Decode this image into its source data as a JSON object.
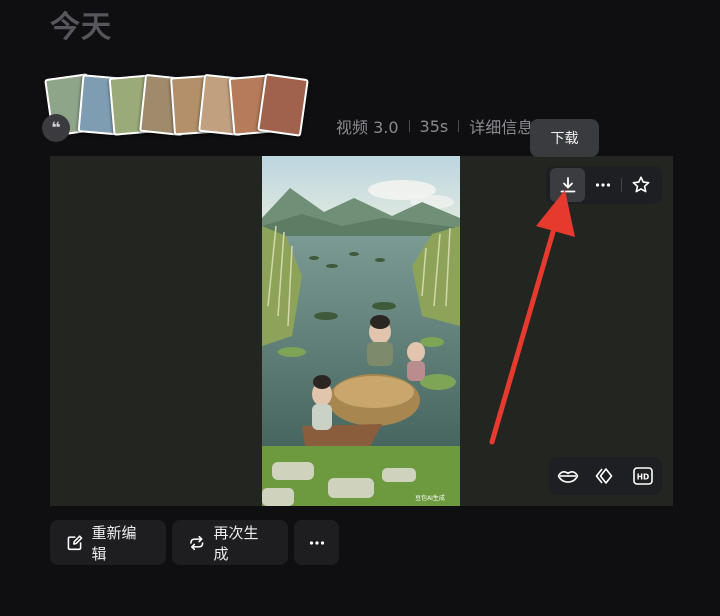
{
  "section": {
    "title": "今天"
  },
  "thumbnails": {
    "count": 8,
    "colors": [
      "#8fa58a",
      "#7f9db2",
      "#9aaa78",
      "#a08a6c",
      "#b3906a",
      "#c0a07e",
      "#b57b5a",
      "#a0624c"
    ],
    "quote_icon": "quote-icon"
  },
  "meta": {
    "model": "视频 3.0",
    "duration": "35s",
    "details": "详细信息"
  },
  "tooltip": {
    "download": "下载"
  },
  "video": {
    "watermark": "豆包AI生成",
    "palette": {
      "sky": "#cfe0e4",
      "mountain": "#6f8f76",
      "water": "#5b7e78",
      "reeds": "#8ea35a",
      "grass": "#6e9a3f"
    }
  },
  "toolbar_top": {
    "download_icon": "download-icon",
    "more_icon": "more-icon",
    "favorite_icon": "star-icon"
  },
  "toolbar_bottom": {
    "lip_sync_icon": "lips-icon",
    "extend_icon": "extend-icon",
    "hd_label": "HD"
  },
  "annotation": {
    "color": "#e63a2e"
  },
  "actions": {
    "reedit": "重新编辑",
    "regenerate": "再次生成",
    "more_icon": "more-icon"
  }
}
